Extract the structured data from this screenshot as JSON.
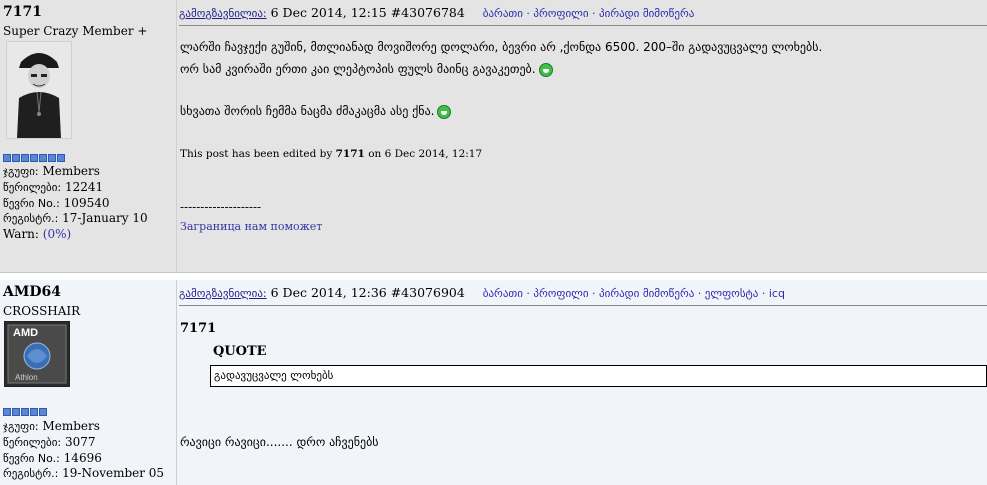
{
  "posts": [
    {
      "username": "7171",
      "rank": "Super Crazy Member +",
      "pips": 7,
      "group_label": "ჯგუფი:",
      "group": "Members",
      "posts_label": "წერილები:",
      "posts": "12241",
      "member_label": "წევრი No.:",
      "member_no": "109540",
      "reg_label": "რეგისტრ.:",
      "registered": "17-January 10",
      "warn_label": "Warn:",
      "warn": "(0%)",
      "header_link": "გამოგზავნილია:",
      "header_text": "6 Dec 2014, 12:15  #43076784",
      "nav": "ბარათი · პროფილი · პირადი მიმოწერა",
      "lines": [
        "ლარში ჩავჯექი გუშინ, მთლიანად მოვიშორე დოლარი, ბევრი არ ,ქონდა 6500. 200–ში გადავუცვალე ლოხებს.",
        "ორ სამ კვირაში ერთი კაი ლეპტოპის ფულს მაინც გავაკეთებ."
      ],
      "line3": "სხვათა შორის ჩემმა ნაცმა ძმაკაცმა ასე ქნა.",
      "edited_prefix": "This post has been edited by",
      "edited_user": "7171",
      "edited_suffix": "on 6 Dec 2014, 12:17",
      "sig_divider": "--------------------",
      "signature": "Заграница нам поможет"
    },
    {
      "username": "AMD64",
      "rank": "CROSSHAIR",
      "pips": 5,
      "group_label": "ჯგუფი:",
      "group": "Members",
      "posts_label": "წერილები:",
      "posts": "3077",
      "member_label": "წევრი No.:",
      "member_no": "14696",
      "reg_label": "რეგისტრ.:",
      "registered": "19-November 05",
      "header_link": "გამოგზავნილია:",
      "header_text": "6 Dec 2014, 12:36  #43076904",
      "nav": "ბარათი · პროფილი · პირადი მიმოწერა · ელფოსტა · icq",
      "quote_author": "7171",
      "quote_title": "QUOTE",
      "quote_text": "გადავუცვალე ლოხებს",
      "reply": "რავიცი რავიცი....... დრო აჩვენებს"
    }
  ],
  "colors": {
    "post1_bg": "#e4e4e4",
    "post2_bg": "#f1f4f8",
    "link": "#2a2ab0"
  }
}
